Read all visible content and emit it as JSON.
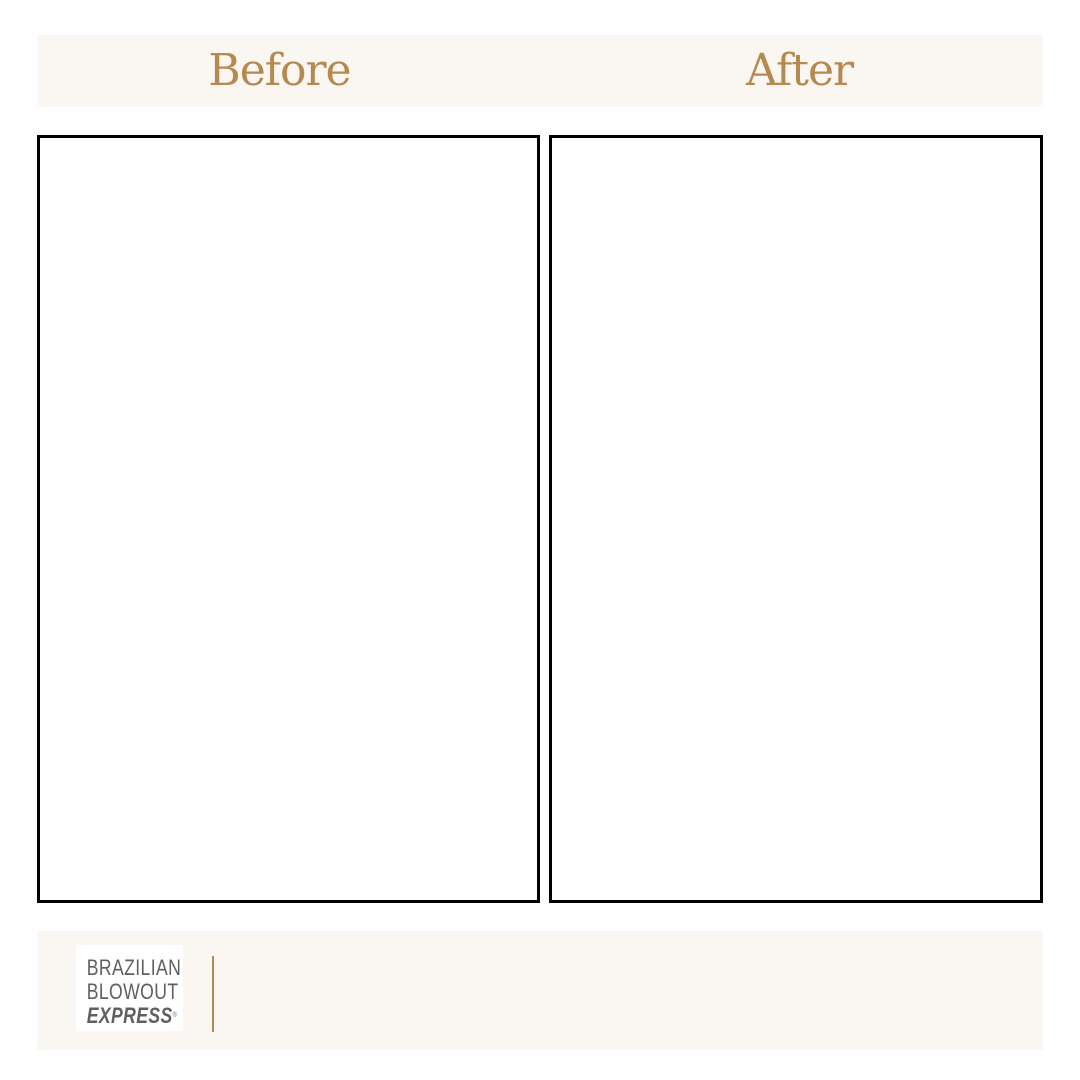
{
  "colors": {
    "accent": "#b5894f",
    "band_background": "#faf6f1",
    "frame_border": "#000000",
    "logo_text": "#5f5f61"
  },
  "header": {
    "before_label": "Before",
    "after_label": "After"
  },
  "footer": {
    "logo": {
      "line1": "BRAZILIAN",
      "line2": "BLOWOUT",
      "line3": "EXPRESS",
      "registered_mark": "®"
    }
  }
}
